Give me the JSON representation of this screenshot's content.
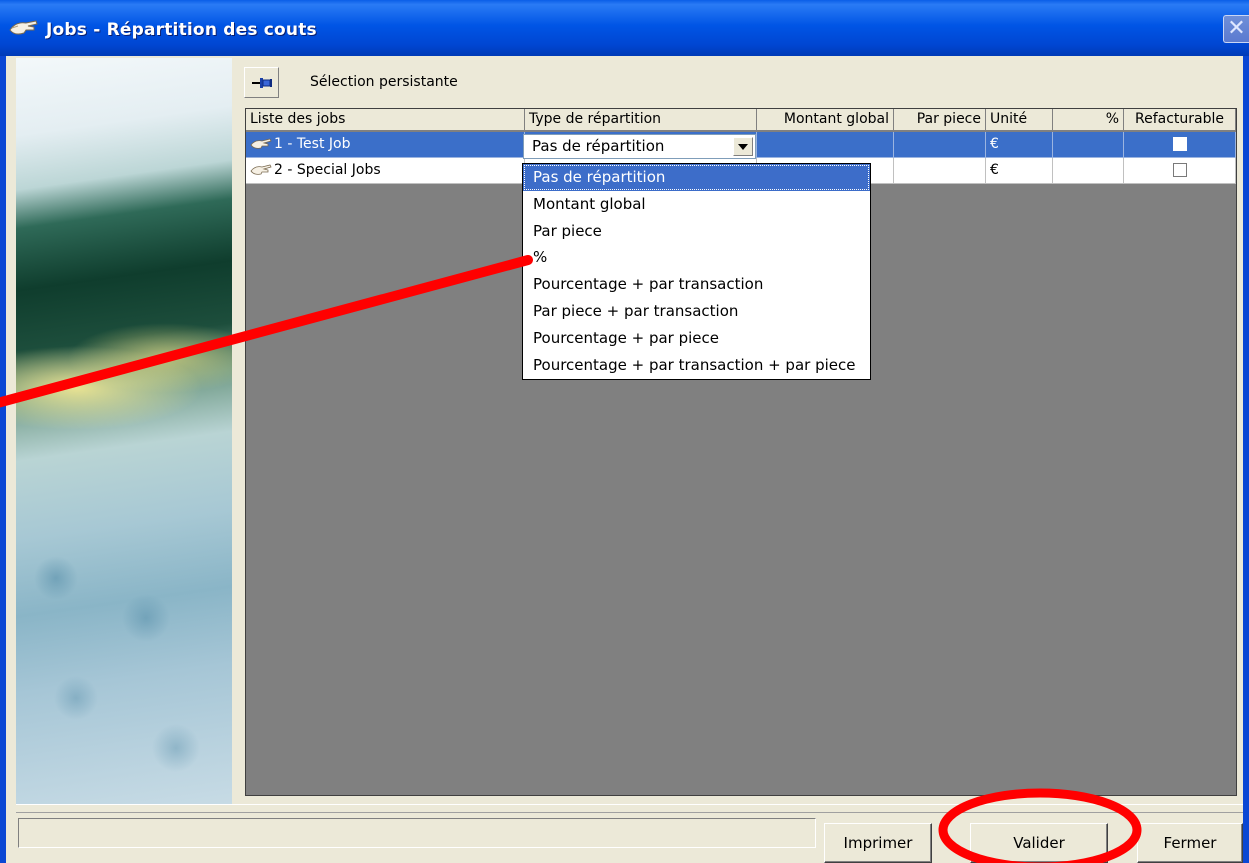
{
  "window": {
    "title": "Jobs - Répartition des couts",
    "close_label": "✕"
  },
  "toolbar": {
    "pin_icon": "pin-icon",
    "persistent_selection_label": "Sélection persistante"
  },
  "grid": {
    "columns": [
      "Liste des jobs",
      "Type de répartition",
      "Montant global",
      "Par piece",
      "Unité",
      "%",
      "Refacturable"
    ],
    "rows": [
      {
        "job": "1 - Test Job",
        "type": "Pas de répartition",
        "montant": "",
        "par_piece": "",
        "unite": "€",
        "pct": "",
        "refacturable": false,
        "selected": true
      },
      {
        "job": "2 - Special Jobs",
        "type": "",
        "montant": "",
        "par_piece": "",
        "unite": "€",
        "pct": "",
        "refacturable": false,
        "selected": false
      }
    ]
  },
  "dropdown": {
    "selected": "Pas de répartition",
    "options": [
      "Pas de répartition",
      "Montant global",
      "Par piece",
      "%",
      "Pourcentage + par transaction",
      "Par piece + par transaction",
      "Pourcentage + par piece",
      "Pourcentage + par transaction + par piece"
    ]
  },
  "footer": {
    "print_label": "Imprimer",
    "validate_label": "Valider",
    "close_label": "Fermer"
  },
  "colors": {
    "titlebar": "#0055e5",
    "selection": "#3b6fc9",
    "annotation": "#ff0000"
  }
}
